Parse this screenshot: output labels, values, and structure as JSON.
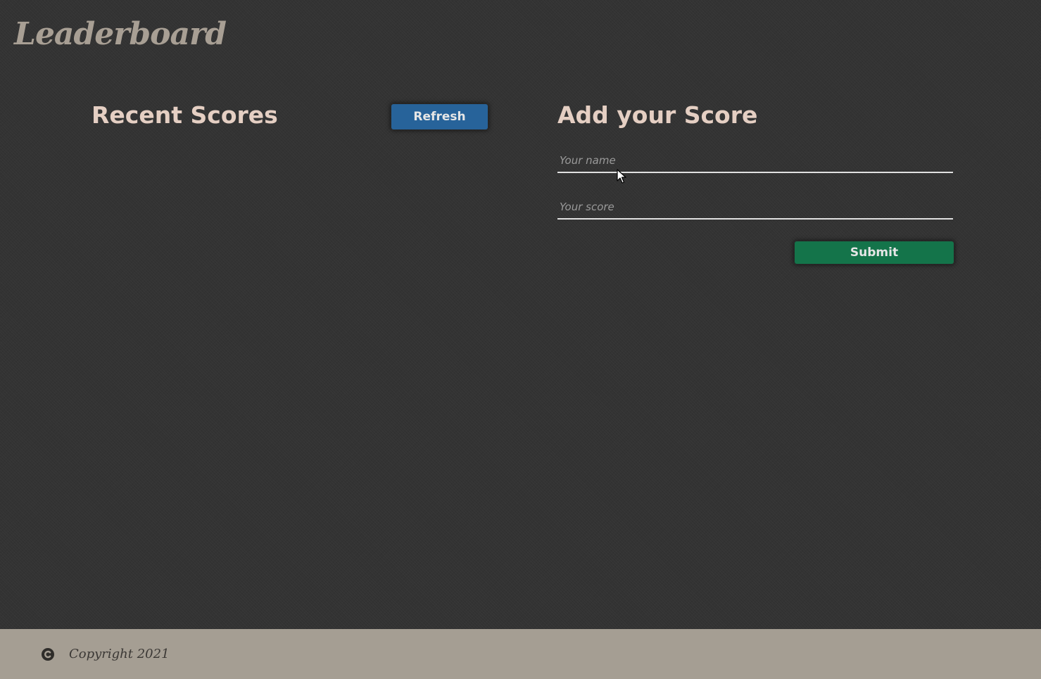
{
  "header": {
    "logo_text": "Leaderboard"
  },
  "recent_scores": {
    "title": "Recent Scores",
    "refresh_label": "Refresh",
    "items": []
  },
  "add_score": {
    "title": "Add your Score",
    "name_placeholder": "Your name",
    "name_value": "",
    "score_placeholder": "Your score",
    "score_value": "",
    "submit_label": "Submit"
  },
  "footer": {
    "icon": "copyright-icon",
    "copyright_text": "Copyright 2021"
  },
  "colors": {
    "background": "#333333",
    "logo": "#a89f94",
    "heading": "#e5cfc3",
    "refresh_button": "#27639a",
    "submit_button": "#14744a",
    "footer_background": "#a59e93",
    "footer_text": "#3b3835"
  }
}
